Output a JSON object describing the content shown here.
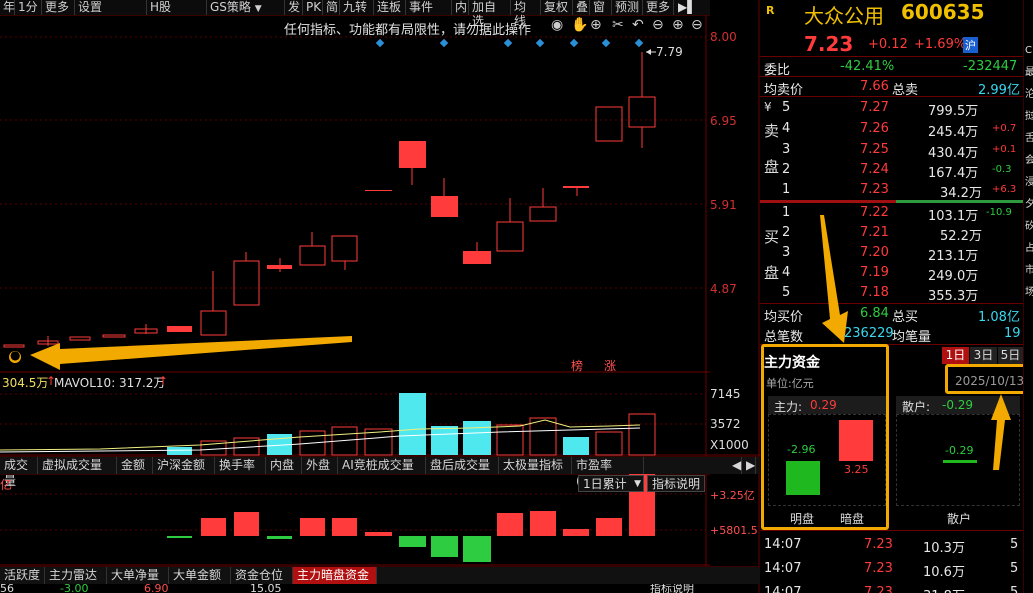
{
  "toolbar": {
    "items": [
      "年",
      "1分",
      "更多",
      "设置",
      "H股",
      "GS策略",
      "发",
      "PK",
      "简",
      "九转",
      "连板",
      "事件",
      "内",
      "加自选",
      "均线",
      "复权",
      "叠",
      "窗",
      "预测",
      "更多"
    ]
  },
  "notice": "任何指标、功能都有局限性，请勿据此操作",
  "price_axis": {
    "labels": [
      "8.00",
      "6.95",
      "5.91",
      "4.87"
    ]
  },
  "max_label": "7.79",
  "marks": {
    "bang": "榜",
    "zhang": "涨"
  },
  "volume": {
    "vol_text": "304.5万",
    "mavol_text": "MAVOL10: 317.2万",
    "axis": [
      "7145",
      "3572",
      "X1000"
    ]
  },
  "indicator_tabs": [
    "成交量",
    "虚拟成交量",
    "金额",
    "沪深金额",
    "换手率",
    "内盘",
    "外盘",
    "AI竞桩成交量",
    "盘后成交量",
    "太极量指标",
    "市盈率(ttm)"
  ],
  "lower": {
    "left_label": "亿",
    "select": "1日累计",
    "select_arrow": "▼",
    "explain": "指标说明",
    "axis": [
      "+3.25亿",
      "+5801.5"
    ]
  },
  "bottom_tabs": [
    "活跃度",
    "主力雷达",
    "大单净量",
    "大单金额",
    "资金仓位",
    "主力暗盘资金"
  ],
  "bottom_status": {
    "left": "56",
    "mid1": "-3.00",
    "mid2": "6.90",
    "mid3": "15.05",
    "explain": "指标说明"
  },
  "quote": {
    "r": "R",
    "name": "大众公用",
    "code": "600635",
    "price": "7.23",
    "change": "+0.12",
    "pct": "+1.69%",
    "market": "沪",
    "weibi_label": "委比",
    "weibi_pct": "-42.41%",
    "weibi_val": "-232447",
    "avg_sell_label": "均卖价",
    "avg_sell": "7.66",
    "total_sell_label": "总卖",
    "total_sell": "2.99亿",
    "sell_side_label": [
      "¥",
      "卖",
      "盘"
    ],
    "sell": [
      {
        "lvl": "5",
        "price": "7.27",
        "vol": "799.5万",
        "chg": ""
      },
      {
        "lvl": "4",
        "price": "7.26",
        "vol": "245.4万",
        "chg": "+0.7"
      },
      {
        "lvl": "3",
        "price": "7.25",
        "vol": "430.4万",
        "chg": "+0.1"
      },
      {
        "lvl": "2",
        "price": "7.24",
        "vol": "167.4万",
        "chg": "-0.3"
      },
      {
        "lvl": "1",
        "price": "7.23",
        "vol": "34.2万",
        "chg": "+6.3"
      }
    ],
    "buy_side_label": [
      "买",
      "盘"
    ],
    "buy": [
      {
        "lvl": "1",
        "price": "7.22",
        "vol": "103.1万",
        "chg": "-10.9"
      },
      {
        "lvl": "2",
        "price": "7.21",
        "vol": "52.2万",
        "chg": ""
      },
      {
        "lvl": "3",
        "price": "7.20",
        "vol": "213.1万",
        "chg": ""
      },
      {
        "lvl": "4",
        "price": "7.19",
        "vol": "249.0万",
        "chg": ""
      },
      {
        "lvl": "5",
        "price": "7.18",
        "vol": "355.3万",
        "chg": ""
      }
    ],
    "avg_buy_label": "均买价",
    "avg_buy": "6.84",
    "total_buy_label": "总买",
    "total_buy": "1.08亿",
    "total_trades_label": "总笔数",
    "total_trades": "236229",
    "avg_vol_label": "均笔量",
    "avg_vol": "19"
  },
  "capital": {
    "title": "主力资金",
    "unit": "单位:亿元",
    "period_tabs": [
      "1日",
      "3日",
      "5日"
    ],
    "date": "2025/10/13",
    "main_label": "主力:",
    "main_val": "0.29",
    "retail_label": "散户:",
    "retail_val": "-0.29",
    "ming_val": "-2.96",
    "an_val": "3.25",
    "retail_bar_val": "-0.29",
    "ming_label": "明盘",
    "an_label": "暗盘",
    "retail_name": "散户"
  },
  "ticks": [
    {
      "time": "14:07",
      "price": "7.23",
      "vol": "10.3万",
      "n": "5"
    },
    {
      "time": "14:07",
      "price": "7.23",
      "vol": "10.6万",
      "n": "5"
    },
    {
      "time": "14:07",
      "price": "7.23",
      "vol": "31.8万",
      "n": "5"
    }
  ],
  "far_right_chars": [
    "C",
    "最",
    "沦",
    "挝",
    "舌",
    "会",
    "浸",
    "夕",
    "矽",
    "占",
    "市",
    "场"
  ],
  "colors": {
    "up": "#ff3b3b",
    "down": "#2ecc40",
    "cyan": "#4fe8ee",
    "accent": "#f2a900"
  }
}
